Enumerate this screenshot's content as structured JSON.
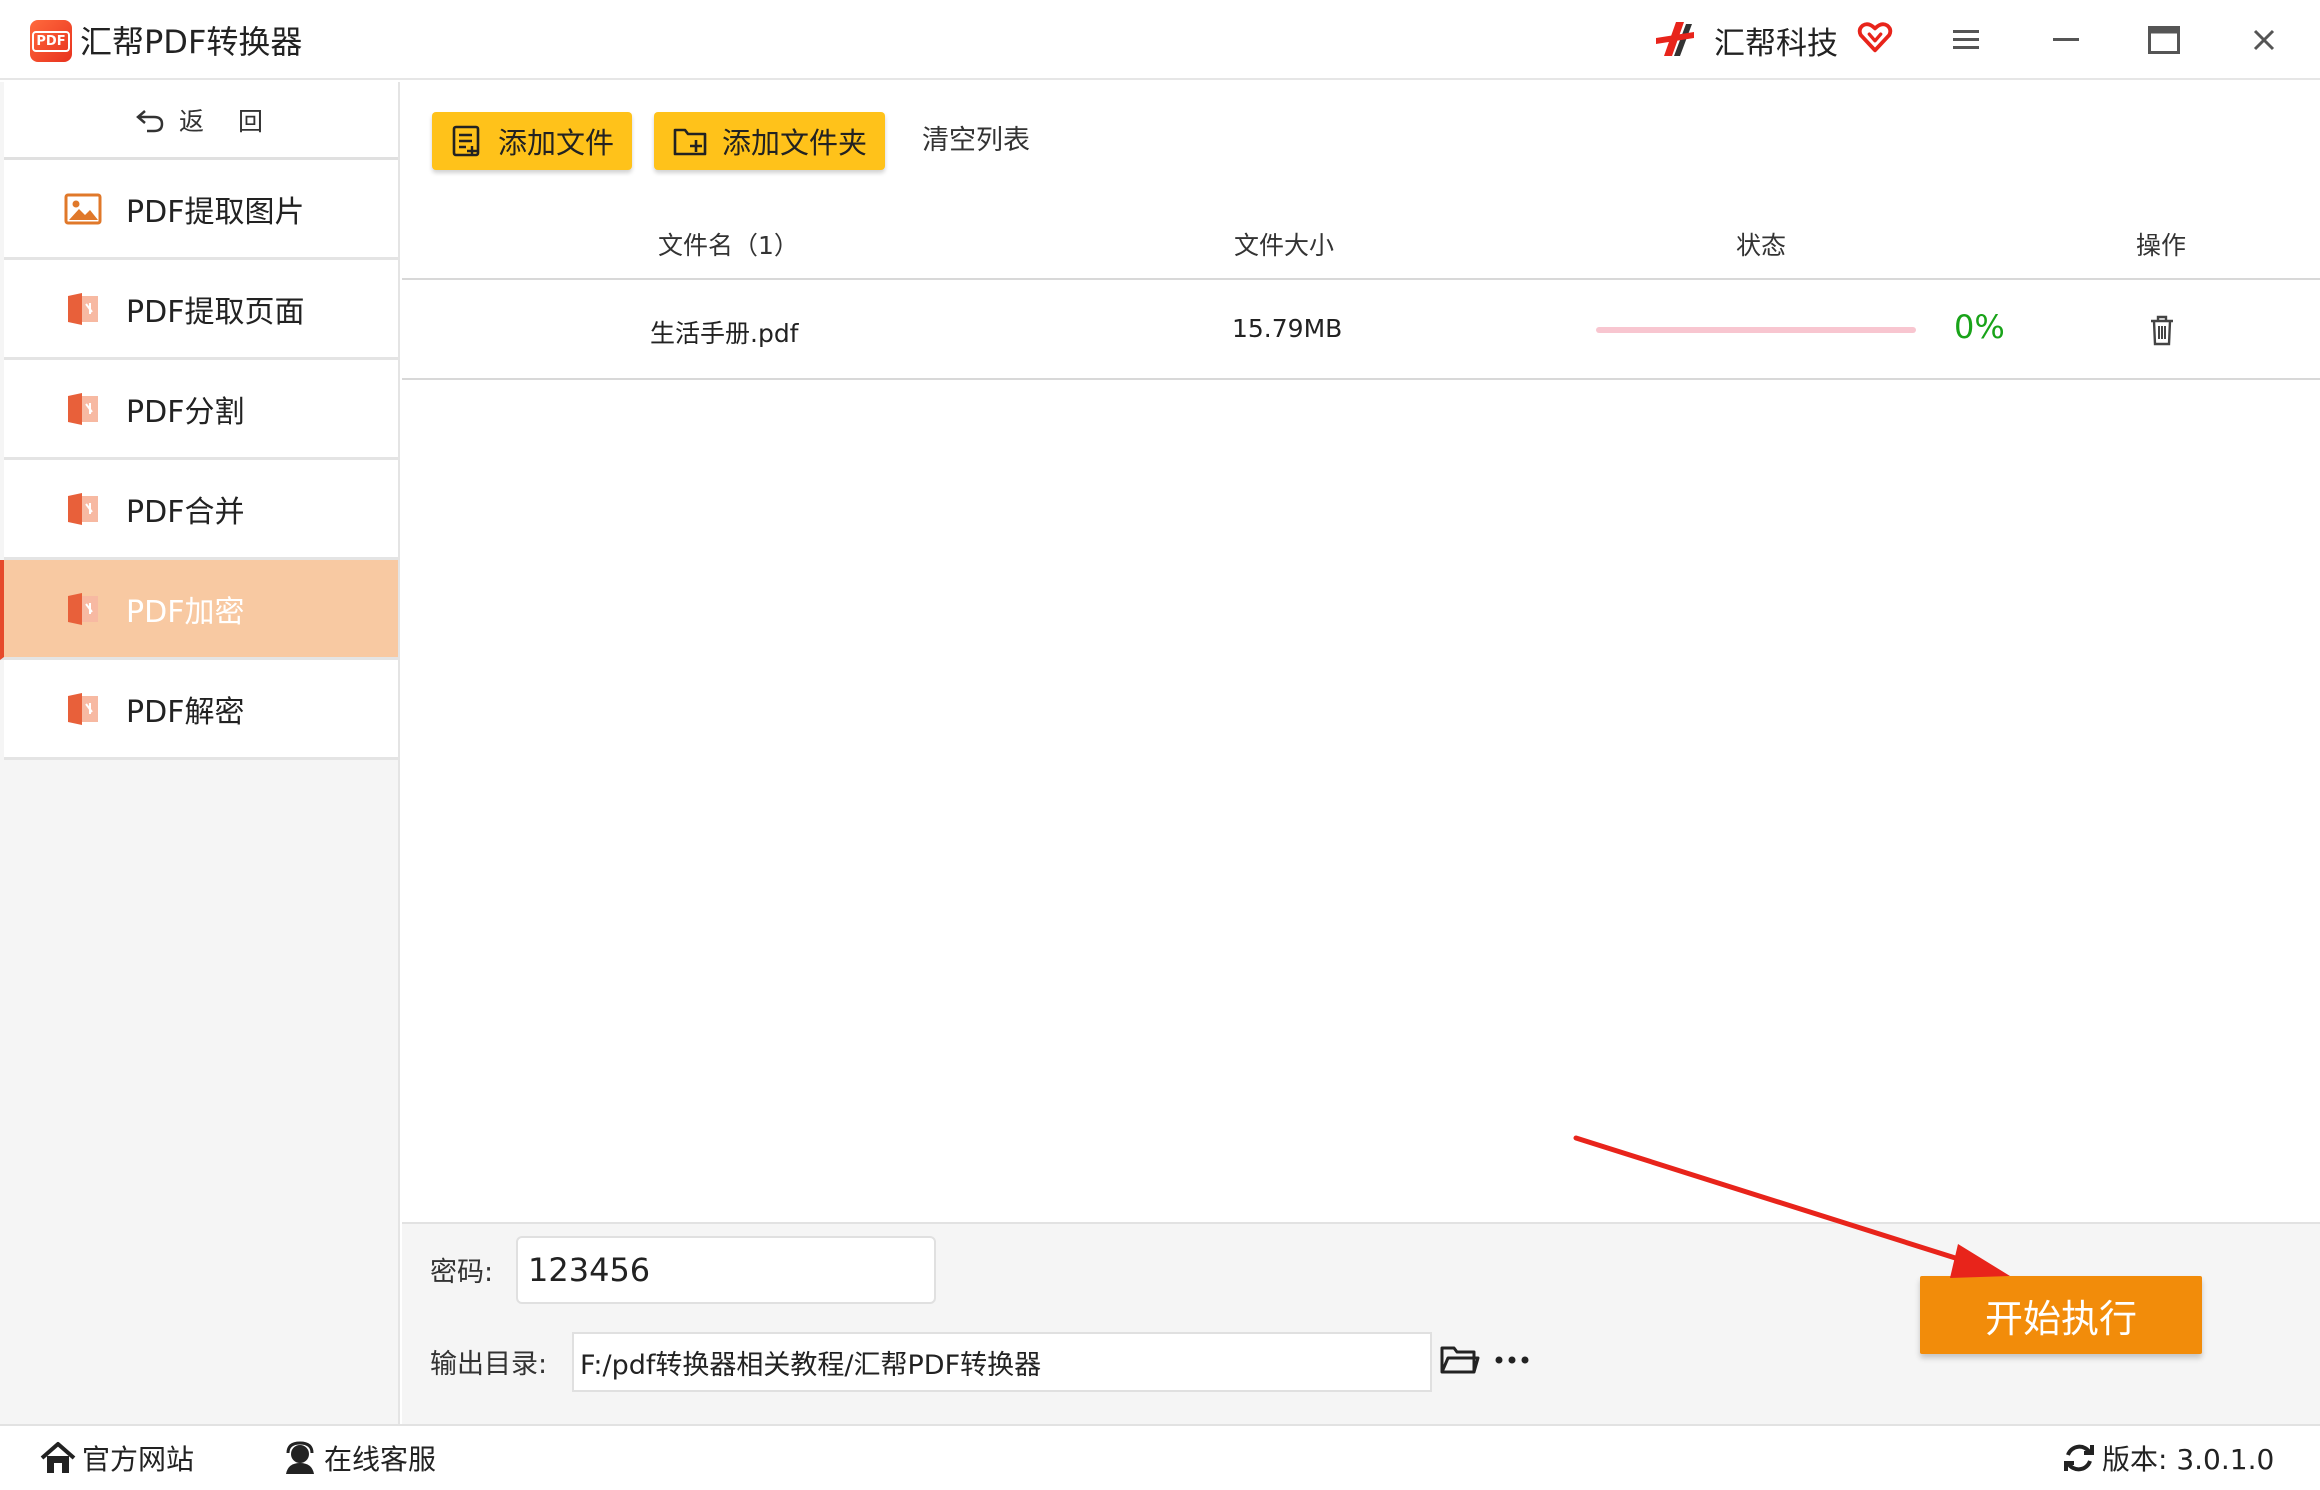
{
  "window": {
    "title": "汇帮PDF转换器",
    "app_logo_text": "PDF",
    "brand_name": "汇帮科技",
    "controls": [
      "menu-icon",
      "minimize-icon",
      "maximize-icon",
      "close-icon"
    ]
  },
  "sidebar": {
    "back_label": "返",
    "back_label_2": "回",
    "items": [
      {
        "label": "PDF提取图片",
        "icon": "image-icon",
        "active": false
      },
      {
        "label": "PDF提取页面",
        "icon": "pdf-file-icon",
        "active": false
      },
      {
        "label": "PDF分割",
        "icon": "pdf-file-icon",
        "active": false
      },
      {
        "label": "PDF合并",
        "icon": "pdf-file-icon",
        "active": false
      },
      {
        "label": "PDF加密",
        "icon": "pdf-file-icon",
        "active": true
      },
      {
        "label": "PDF解密",
        "icon": "pdf-file-icon",
        "active": false
      }
    ]
  },
  "toolbar": {
    "add_file": "添加文件",
    "add_folder": "添加文件夹",
    "clear_list": "清空列表"
  },
  "table": {
    "headers": {
      "name": "文件名（1）",
      "size": "文件大小",
      "status": "状态",
      "action": "操作"
    },
    "rows": [
      {
        "name": "生活手册.pdf",
        "size": "15.79MB",
        "progress": 0,
        "percent": "0%"
      }
    ]
  },
  "settings": {
    "password_label": "密码:",
    "password_value": "123456",
    "output_label": "输出目录:",
    "output_value": "F:/pdf转换器相关教程/汇帮PDF转换器",
    "start_label": "开始执行"
  },
  "statusbar": {
    "website": "官方网站",
    "support": "在线客服",
    "version": "版本: 3.0.1.0"
  },
  "colors": {
    "accent_yellow": "#ffc21a",
    "start_orange": "#f28c0a",
    "active_nav": "#f8c9a2",
    "progress_green": "#19a319",
    "annotation_red": "#e8241b"
  }
}
